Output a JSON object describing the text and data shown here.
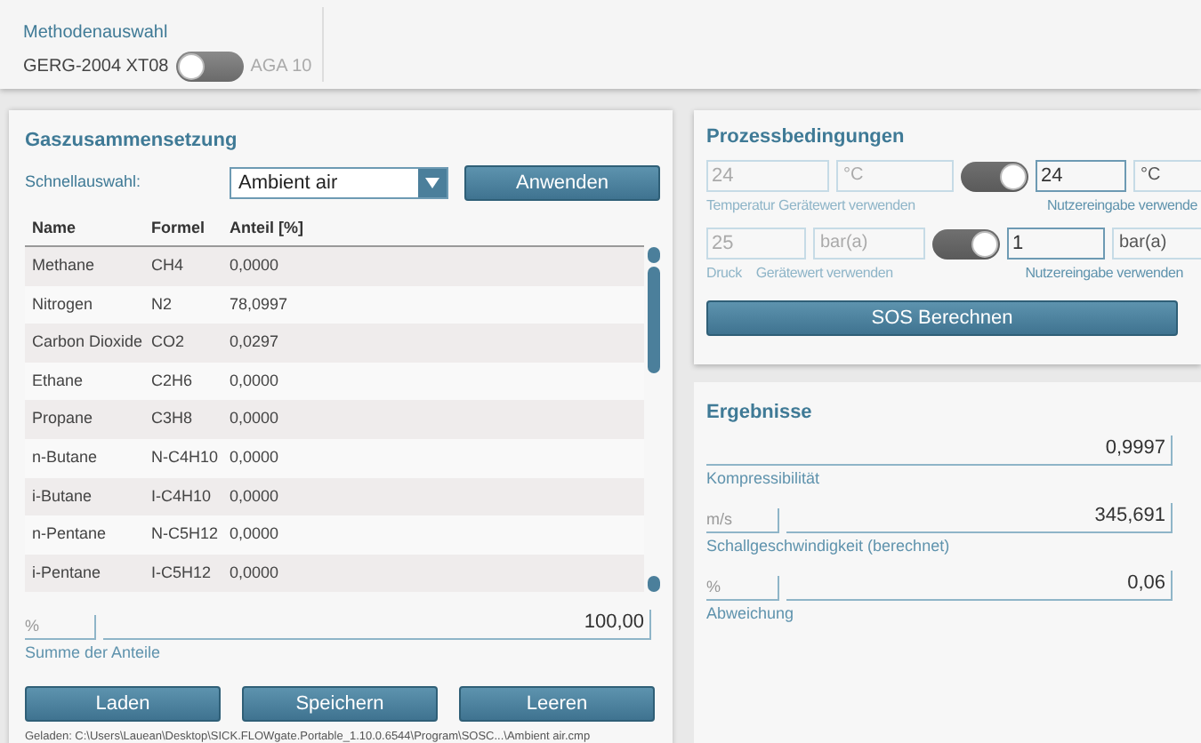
{
  "method": {
    "title": "Methodenauswahl",
    "left": "GERG-2004 XT08",
    "right": "AGA 10",
    "on": false
  },
  "composition": {
    "title": "Gaszusammensetzung",
    "quick_label": "Schnellauswahl:",
    "quick_value": "Ambient air",
    "apply": "Anwenden",
    "columns": [
      "Name",
      "Formel",
      "Anteil [%]"
    ],
    "rows": [
      {
        "name": "Methane",
        "formula": "CH4",
        "share": "0,0000"
      },
      {
        "name": "Nitrogen",
        "formula": "N2",
        "share": "78,0997"
      },
      {
        "name": "Carbon Dioxide",
        "formula": "CO2",
        "share": "0,0297"
      },
      {
        "name": "Ethane",
        "formula": "C2H6",
        "share": "0,0000"
      },
      {
        "name": "Propane",
        "formula": "C3H8",
        "share": "0,0000"
      },
      {
        "name": "n-Butane",
        "formula": "N-C4H10",
        "share": "0,0000"
      },
      {
        "name": "i-Butane",
        "formula": "I-C4H10",
        "share": "0,0000"
      },
      {
        "name": "n-Pentane",
        "formula": "N-C5H12",
        "share": "0,0000"
      },
      {
        "name": "i-Pentane",
        "formula": "I-C5H12",
        "share": "0,0000"
      }
    ],
    "sum": {
      "unit": "%",
      "value": "100,00",
      "label": "Summe der Anteile"
    },
    "buttons": [
      "Laden",
      "Speichern",
      "Leeren"
    ],
    "loaded": "Geladen:  C:\\Users\\Lauean\\Desktop\\SICK.FLOWgate.Portable_1.10.0.6544\\Program\\SOSC...\\Ambient air.cmp"
  },
  "process": {
    "title": "Prozessbedingungen",
    "rows": [
      {
        "device_value": "24",
        "device_unit": "°C",
        "on": true,
        "user_value": "24",
        "user_unit": "°C",
        "label": "Temperatur",
        "device_label": "Gerätewert verwenden",
        "user_label": "Nutzereingabe verwende"
      },
      {
        "device_value": "25",
        "device_unit": "bar(a)",
        "on": true,
        "user_value": "1",
        "user_unit": "bar(a)",
        "label": "Druck",
        "device_label": "Gerätewert verwenden",
        "user_label": "Nutzereingabe verwenden"
      }
    ],
    "button": "SOS Berechnen"
  },
  "results": {
    "title": "Ergebnisse",
    "items": [
      {
        "value": "0,9997",
        "label": "Kompressibilität"
      },
      {
        "unit": "m/s",
        "value": "345,691",
        "label": "Schallgeschwindigkeit (berechnet)"
      },
      {
        "unit": "%",
        "value": "0,06",
        "label": "Abweichung"
      }
    ]
  }
}
